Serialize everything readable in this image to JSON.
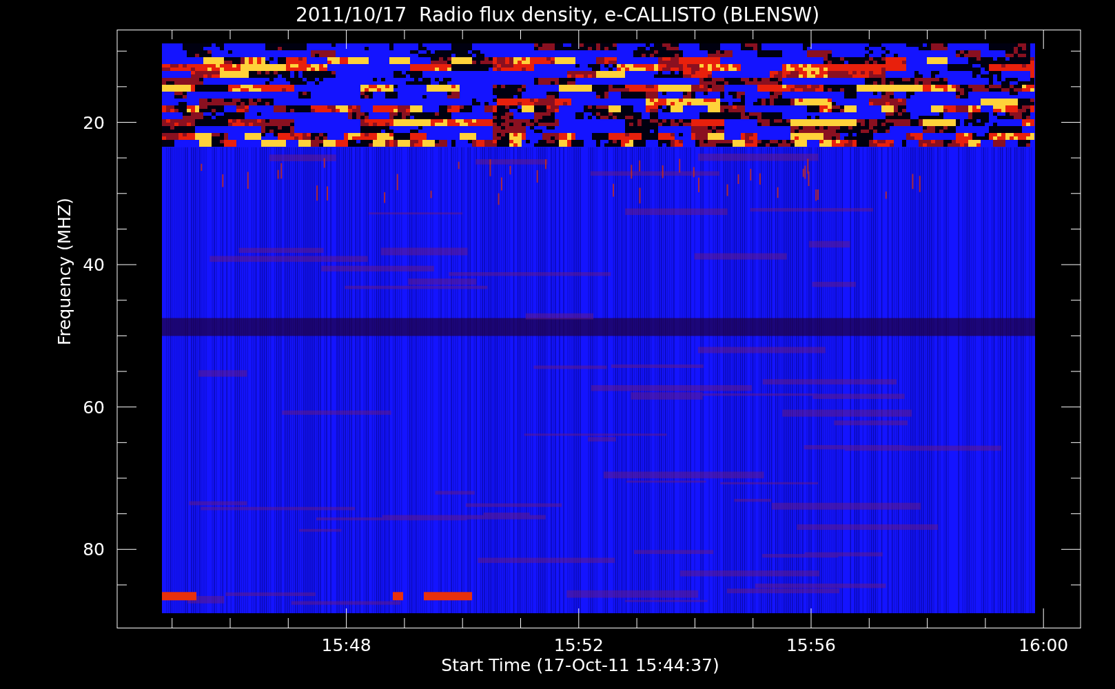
{
  "title": "2011/10/17  Radio flux density, e-CALLISTO (BLENSW)",
  "y_axis": {
    "label": "Frequency (MHZ)",
    "ticks": [
      "20",
      "40",
      "60",
      "80"
    ]
  },
  "x_axis": {
    "label": "Start Time (17-Oct-11 15:44:37)",
    "ticks": [
      "15:48",
      "15:52",
      "15:56",
      "16:00"
    ]
  }
}
